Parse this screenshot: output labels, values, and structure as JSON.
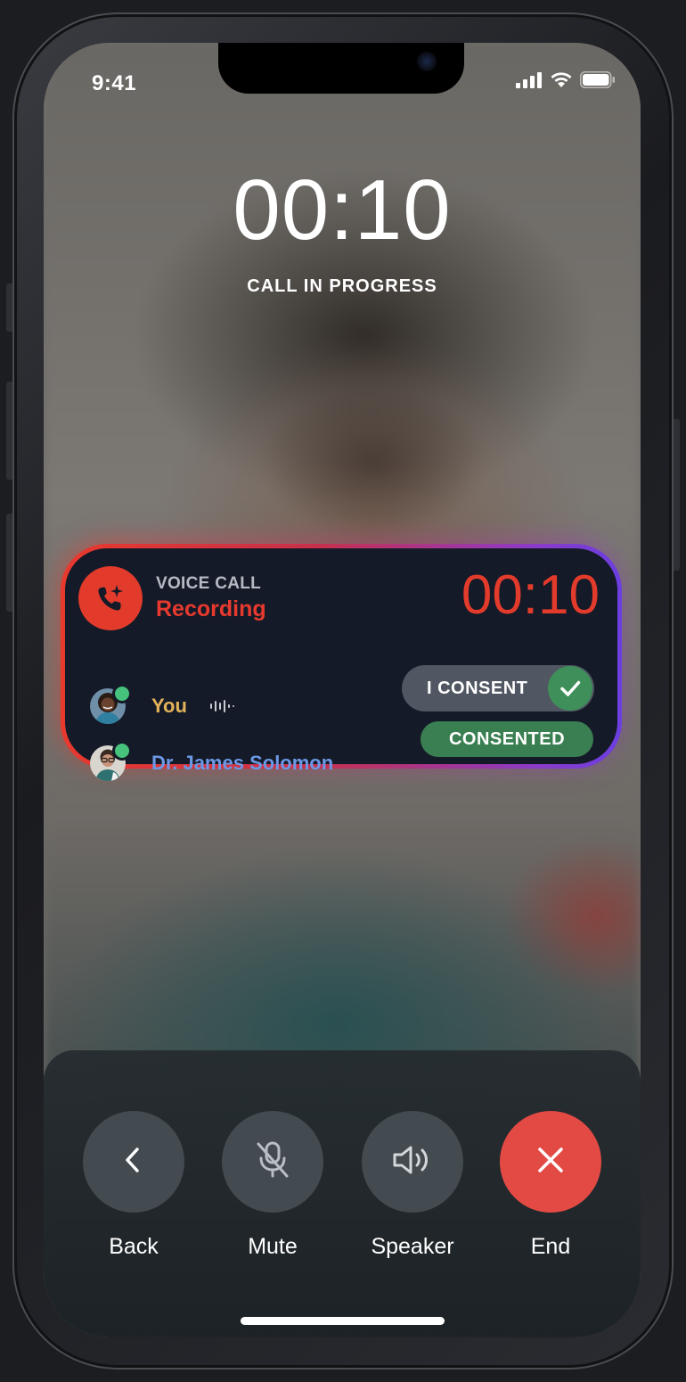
{
  "status_bar": {
    "time": "9:41",
    "icons": [
      "cellular-signal-icon",
      "wifi-icon",
      "battery-icon"
    ]
  },
  "call": {
    "timer": "00:10",
    "status": "CALL IN PROGRESS"
  },
  "recording_card": {
    "icon": "phone-sparkle-icon",
    "type_label": "VOICE CALL",
    "state_label": "Recording",
    "timer": "00:10",
    "participants": [
      {
        "name": "You",
        "online": true,
        "speaking_icon": "waveform-icon",
        "action": "I CONSENT",
        "action_icon": "checkmark-icon"
      },
      {
        "name": "Dr. James Solomon",
        "online": true,
        "status": "CONSENTED"
      }
    ]
  },
  "controls": [
    {
      "label": "Back",
      "icon": "chevron-left-icon"
    },
    {
      "label": "Mute",
      "icon": "mic-off-icon"
    },
    {
      "label": "Speaker",
      "icon": "speaker-icon"
    },
    {
      "label": "End",
      "icon": "close-icon"
    }
  ],
  "colors": {
    "recording_red": "#E23B2C",
    "card_background": "#141A27",
    "you_name": "#E3B35A",
    "doctor_name": "#6C98E6",
    "consent_green": "#3A7F52",
    "online_green": "#47C27C",
    "end_button": "#E44A44",
    "control_button": "#434A50"
  }
}
